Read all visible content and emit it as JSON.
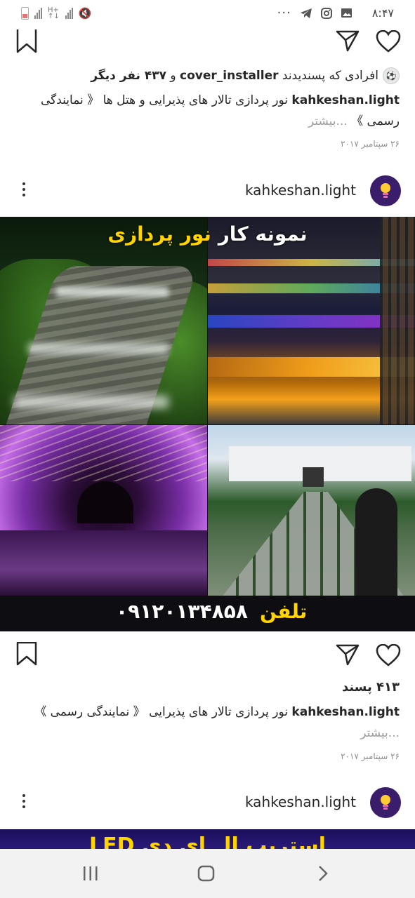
{
  "status": {
    "time": "۸:۴۷",
    "dots": "···"
  },
  "post1": {
    "liked_prefix": "افرادی که پسندیدند",
    "liked_user": "cover_installer",
    "liked_and": "و",
    "liked_others": "۴۳۷ نفر دیگر",
    "caption_user": "kahkeshan.light",
    "caption_text": "نور پردازی تالار های پذیرایی و هتل ها 《 نمایندگی رسمی 》",
    "more": "...بیشتر",
    "date": "۲۶ سپتامبر ۲۰۱۷"
  },
  "post2": {
    "username": "kahkeshan.light",
    "image": {
      "headline_white": "نمونه کار",
      "headline_yellow": "نور پردازی",
      "phone_label": "تلفن",
      "phone_number": "۰۹۱۲۰۱۳۴۸۵۸",
      "tiles": [
        "garden-path-lights",
        "colored-stair-lights",
        "purple-light-tunnel",
        "hall-courtyard"
      ]
    },
    "likes": "۴۱۳ پسند",
    "caption_user": "kahkeshan.light",
    "caption_text": "نور پردازی تالار های پذیرایی 《 نمایندگی رسمی 》",
    "more": "...بیشتر",
    "date": "۲۶ سپتامبر ۲۰۱۷"
  },
  "post3": {
    "username": "kahkeshan.light",
    "image_text": "استریپ ال ای دی LED"
  },
  "icons": {
    "bookmark": "bookmark-icon",
    "share": "send-icon",
    "like": "heart-icon",
    "menu": "more-options-icon"
  },
  "colors": {
    "accent_yellow": "#ffd400",
    "avatar_bg": "#3b1e6b",
    "navbar_bg": "#f2f2f2"
  }
}
